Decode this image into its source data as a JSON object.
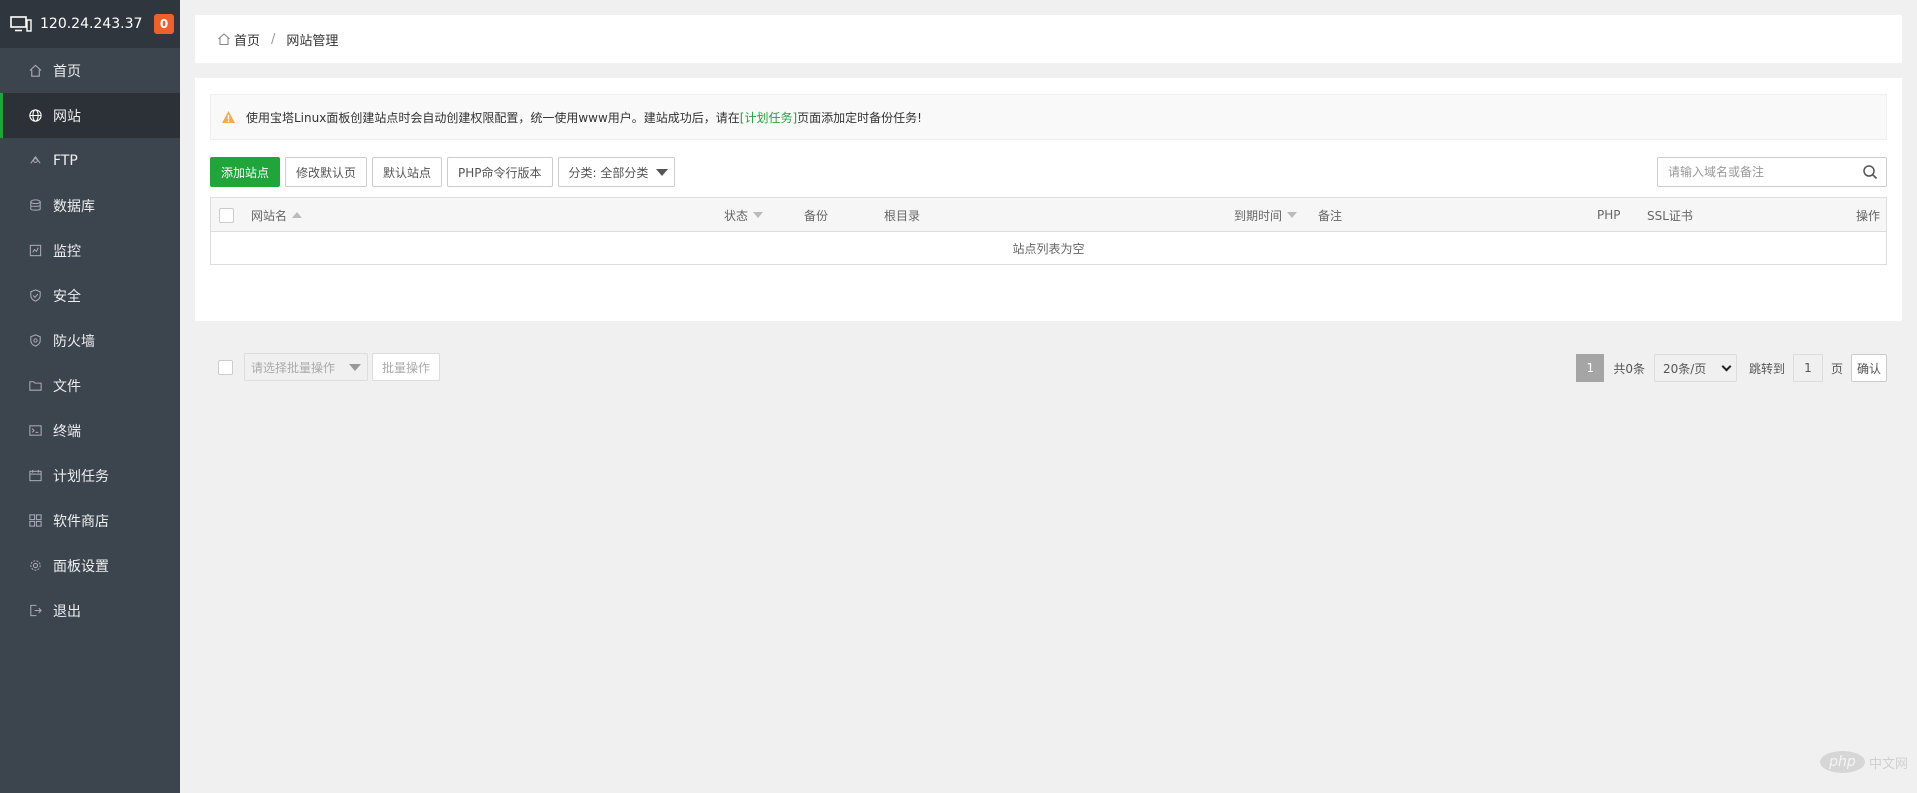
{
  "sidebar": {
    "ip": "120.24.243.37",
    "badge_count": "0",
    "items": [
      {
        "label": "首页",
        "icon": "home-icon"
      },
      {
        "label": "网站",
        "icon": "globe-icon",
        "active": true
      },
      {
        "label": "FTP",
        "icon": "ftp-icon"
      },
      {
        "label": "数据库",
        "icon": "database-icon"
      },
      {
        "label": "监控",
        "icon": "monitor-chart-icon"
      },
      {
        "label": "安全",
        "icon": "shield-icon"
      },
      {
        "label": "防火墙",
        "icon": "firewall-icon"
      },
      {
        "label": "文件",
        "icon": "folder-icon"
      },
      {
        "label": "终端",
        "icon": "terminal-icon"
      },
      {
        "label": "计划任务",
        "icon": "calendar-icon"
      },
      {
        "label": "软件商店",
        "icon": "apps-grid-icon"
      },
      {
        "label": "面板设置",
        "icon": "gear-icon"
      },
      {
        "label": "退出",
        "icon": "logout-icon"
      }
    ],
    "colors": {
      "bg": "#3c444d",
      "active": "#20a53a"
    }
  },
  "breadcrumb": {
    "home": "首页",
    "separator": "/",
    "current": "网站管理"
  },
  "notice": {
    "text_before": "使用宝塔Linux面板创建站点时会自动创建权限配置，统一使用www用户。建站成功后，请在",
    "link": "[计划任务]",
    "text_after": "页面添加定时备份任务!"
  },
  "toolbar": {
    "add_site": "添加站点",
    "edit_default_page": "修改默认页",
    "default_site": "默认站点",
    "php_cli_version": "PHP命令行版本",
    "category": "分类: 全部分类"
  },
  "search": {
    "placeholder": "请输入域名或备注"
  },
  "table": {
    "columns": {
      "site_name": "网站名",
      "status": "状态",
      "backup": "备份",
      "root_dir": "根目录",
      "expire": "到期时间",
      "remark": "备注",
      "php": "PHP",
      "ssl": "SSL证书",
      "actions": "操作"
    },
    "empty_text": "站点列表为空"
  },
  "batch": {
    "select_placeholder": "请选择批量操作",
    "button": "批量操作"
  },
  "pagination": {
    "current_page": "1",
    "total": "共0条",
    "page_size": "20条/页",
    "jump_label": "跳转到",
    "jump_value": "1",
    "page_unit": "页",
    "confirm": "确认"
  },
  "watermark": {
    "logo_text": "php",
    "site": "中文网"
  },
  "colors": {
    "accent": "#20a53a",
    "warning": "#f0ad4e",
    "badge": "#f0602b"
  }
}
